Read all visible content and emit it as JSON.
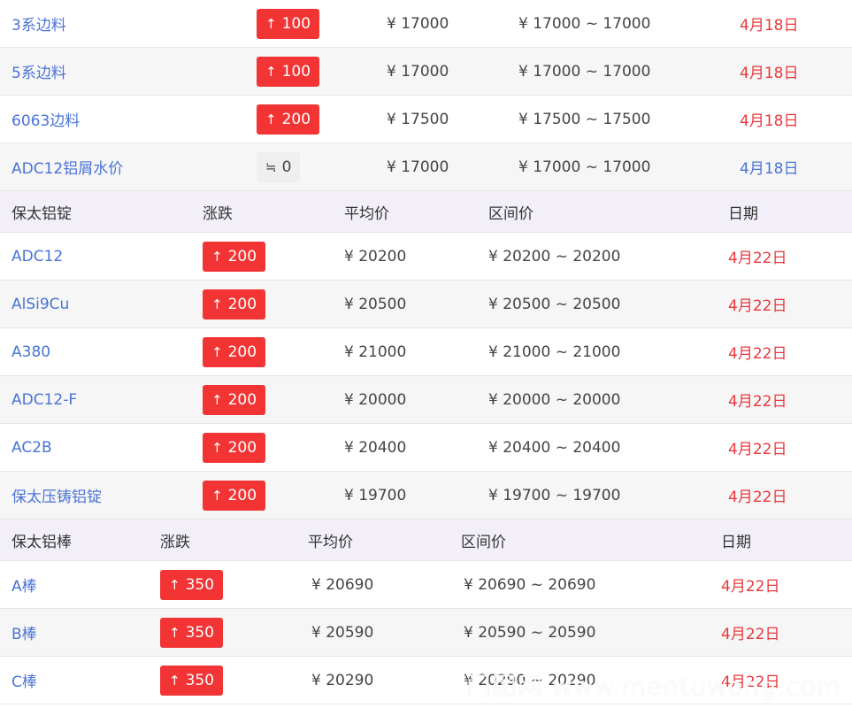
{
  "group1": {
    "rows": [
      {
        "name": "3系边料",
        "change": "100",
        "change_dir": "up",
        "avg": "¥ 17000",
        "range": "¥ 17000 ~ 17000",
        "date": "4月18日"
      },
      {
        "name": "5系边料",
        "change": "100",
        "change_dir": "up",
        "avg": "¥ 17000",
        "range": "¥ 17000 ~ 17000",
        "date": "4月18日"
      },
      {
        "name": "6063边料",
        "change": "200",
        "change_dir": "up",
        "avg": "¥ 17500",
        "range": "¥ 17500 ~ 17500",
        "date": "4月18日"
      },
      {
        "name": "ADC12铝屑水价",
        "change": "0",
        "change_dir": "flat",
        "avg": "¥ 17000",
        "range": "¥ 17000 ~ 17000",
        "date": "4月18日"
      }
    ]
  },
  "group2": {
    "header": {
      "name": "保太铝锭",
      "change": "涨跌",
      "avg": "平均价",
      "range": "区间价",
      "date": "日期"
    },
    "rows": [
      {
        "name": "ADC12",
        "change": "200",
        "change_dir": "up",
        "avg": "¥ 20200",
        "range": "¥ 20200 ~ 20200",
        "date": "4月22日"
      },
      {
        "name": "AlSi9Cu",
        "change": "200",
        "change_dir": "up",
        "avg": "¥ 20500",
        "range": "¥ 20500 ~ 20500",
        "date": "4月22日"
      },
      {
        "name": "A380",
        "change": "200",
        "change_dir": "up",
        "avg": "¥ 21000",
        "range": "¥ 21000 ~ 21000",
        "date": "4月22日"
      },
      {
        "name": "ADC12-F",
        "change": "200",
        "change_dir": "up",
        "avg": "¥ 20000",
        "range": "¥ 20000 ~ 20000",
        "date": "4月22日"
      },
      {
        "name": "AC2B",
        "change": "200",
        "change_dir": "up",
        "avg": "¥ 20400",
        "range": "¥ 20400 ~ 20400",
        "date": "4月22日"
      },
      {
        "name": "保太压铸铝锭",
        "change": "200",
        "change_dir": "up",
        "avg": "¥ 19700",
        "range": "¥ 19700 ~ 19700",
        "date": "4月22日"
      }
    ]
  },
  "group3": {
    "header": {
      "name": "保太铝棒",
      "change": "涨跌",
      "avg": "平均价",
      "range": "区间价",
      "date": "日期"
    },
    "rows": [
      {
        "name": "A棒",
        "change": "350",
        "change_dir": "up",
        "avg": "¥ 20690",
        "range": "¥ 20690 ~ 20690",
        "date": "4月22日"
      },
      {
        "name": "B棒",
        "change": "350",
        "change_dir": "up",
        "avg": "¥ 20590",
        "range": "¥ 20590 ~ 20590",
        "date": "4月22日"
      },
      {
        "name": "C棒",
        "change": "350",
        "change_dir": "up",
        "avg": "¥ 20290",
        "range": "¥ 20290 ~ 20290",
        "date": "4月22日"
      }
    ]
  },
  "icons": {
    "up": "↑",
    "flat": "≒"
  },
  "watermark": "门图网 www.mentuwang.com",
  "colors": {
    "up_badge": "#f23434",
    "flat_badge": "#efefef",
    "name_link": "#4a73d6",
    "date_red": "#e8383d",
    "date_blue": "#4a73d6",
    "header_bg": "#f2eff8"
  }
}
